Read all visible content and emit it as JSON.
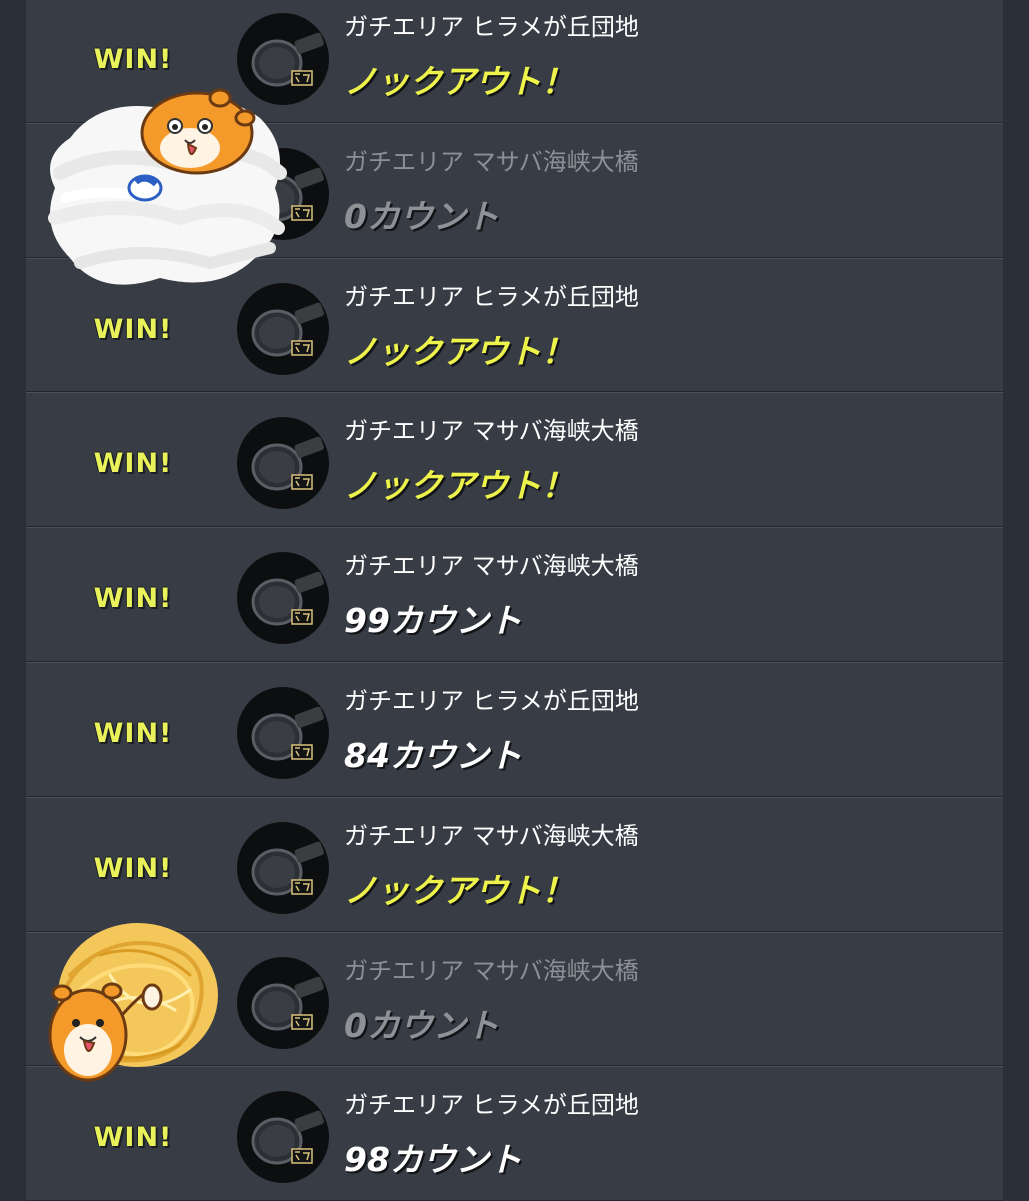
{
  "colors": {
    "background": "#2b3038",
    "row": "#373c45",
    "win": "#e9f25a",
    "knockout": "#eef34b",
    "muted": "#8c9096"
  },
  "battles": [
    {
      "result": "WIN!",
      "stage": "ガチエリア ヒラメが丘団地",
      "outcome": "ノックアウト！",
      "knockout": true,
      "lose": false
    },
    {
      "result": "",
      "stage": "ガチエリア マサバ海峡大橋",
      "outcome": "0カウント",
      "knockout": false,
      "lose": true
    },
    {
      "result": "WIN!",
      "stage": "ガチエリア ヒラメが丘団地",
      "outcome": "ノックアウト！",
      "knockout": true,
      "lose": false
    },
    {
      "result": "WIN!",
      "stage": "ガチエリア マサバ海峡大橋",
      "outcome": "ノックアウト！",
      "knockout": true,
      "lose": false
    },
    {
      "result": "WIN!",
      "stage": "ガチエリア マサバ海峡大橋",
      "outcome": "99カウント",
      "knockout": false,
      "lose": false
    },
    {
      "result": "WIN!",
      "stage": "ガチエリア ヒラメが丘団地",
      "outcome": "84カウント",
      "knockout": false,
      "lose": false
    },
    {
      "result": "WIN!",
      "stage": "ガチエリア マサバ海峡大橋",
      "outcome": "ノックアウト！",
      "knockout": true,
      "lose": false
    },
    {
      "result": "",
      "stage": "ガチエリア マサバ海峡大橋",
      "outcome": "0カウント",
      "knockout": false,
      "lose": true
    },
    {
      "result": "WIN!",
      "stage": "ガチエリア ヒラメが丘団地",
      "outcome": "98カウント",
      "knockout": false,
      "lose": false
    }
  ],
  "icons": {
    "weapon": "frying-pan-weapon-icon",
    "sticker_top": "hamster-on-cloud-sticker",
    "sticker_bottom": "hamster-on-scribble-sticker"
  }
}
